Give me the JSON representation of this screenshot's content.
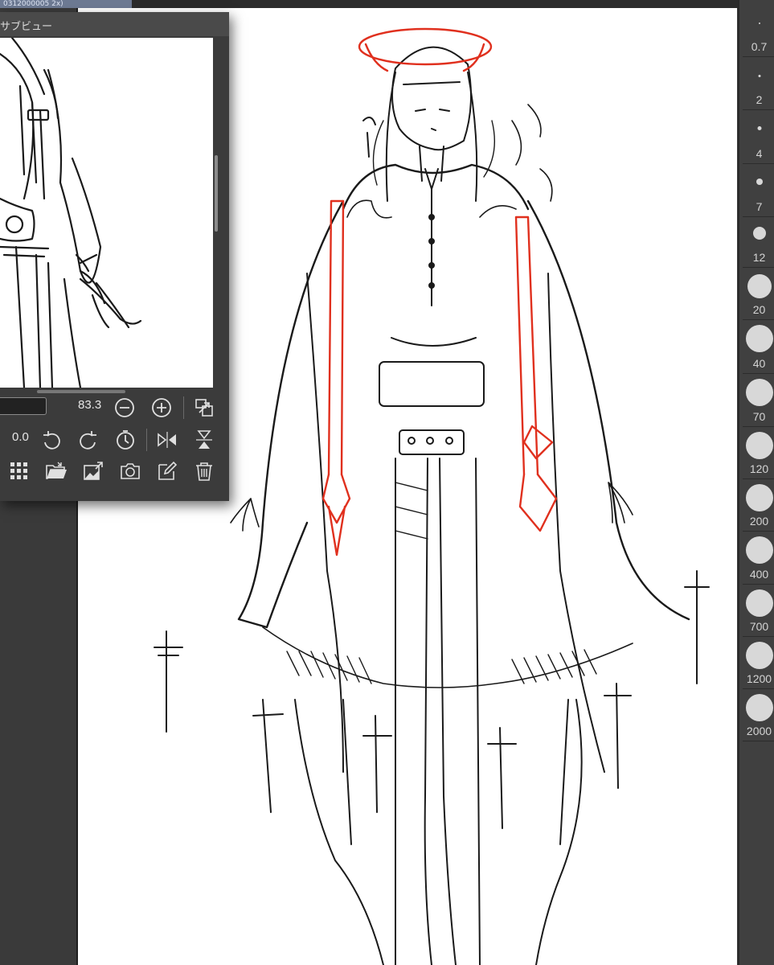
{
  "titlebar": {
    "doc_tab": "0312000005 2x)"
  },
  "nav_panel": {
    "title": "サブビュー",
    "zoom_value": "83.3",
    "rotation_value": "0.0",
    "row1_icons": [
      "zoom-out-icon",
      "zoom-in-icon",
      "fit-screen-icon"
    ],
    "row2_icons": [
      "rotate-left-icon",
      "rotate-right-icon",
      "reset-rotation-icon",
      "flip-horizontal-icon",
      "flip-vertical-icon"
    ],
    "row3_icons": [
      "grid-icon",
      "open-folder-icon",
      "import-icon",
      "camera-icon",
      "edit-icon",
      "trash-icon"
    ]
  },
  "brush_sizes": [
    "0.7",
    "2",
    "4",
    "7",
    "12",
    "20",
    "40",
    "70",
    "120",
    "200",
    "400",
    "700",
    "1200",
    "2000"
  ],
  "colors": {
    "ui_dark": "#3b3b3b",
    "canvas": "#ffffff",
    "sketch_line": "#1a1a1a",
    "accent_red": "#e0301e"
  }
}
